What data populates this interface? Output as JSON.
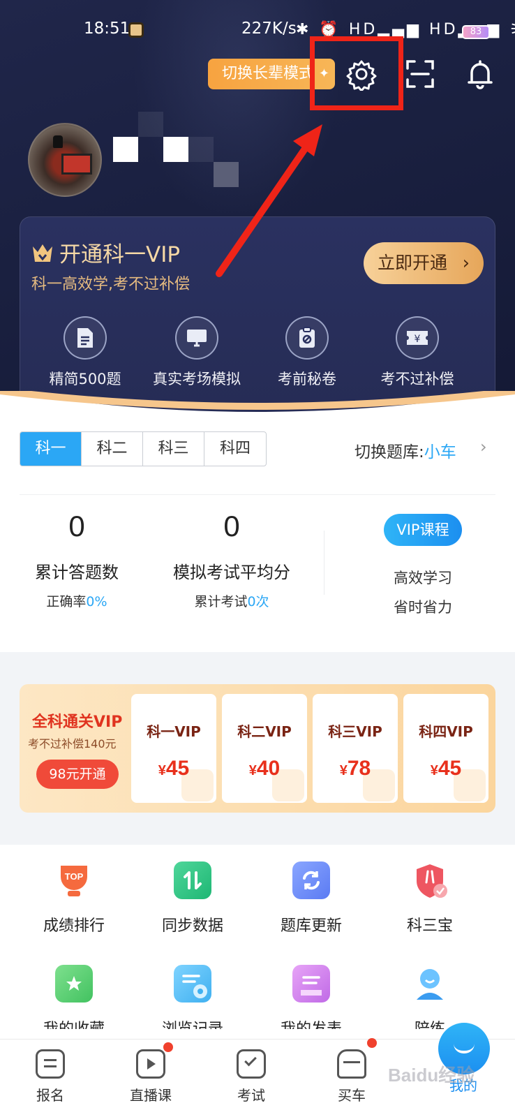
{
  "status_bar": {
    "time": "18:51",
    "speed": "227K/s",
    "icons": "✱ ⏰ HD▂▄▆ HD▂▄▆ ⚞",
    "battery": "83"
  },
  "header": {
    "elder_mode_label": "切换长辈模式",
    "highlight_color": "#ef2418"
  },
  "vip_card": {
    "title": "开通科一VIP",
    "subtitle": "科一高效学,考不过补偿",
    "open_button": "立即开通",
    "features": [
      {
        "label": "精简500题",
        "icon": "document-icon"
      },
      {
        "label": "真实考场模拟",
        "icon": "monitor-icon"
      },
      {
        "label": "考前秘卷",
        "icon": "secret-paper-icon"
      },
      {
        "label": "考不过补偿",
        "icon": "refund-ticket-icon"
      }
    ]
  },
  "subject_tabs": [
    "科一",
    "科二",
    "科三",
    "科四"
  ],
  "question_bank": {
    "label": "切换题库:",
    "value": "小车"
  },
  "stats": {
    "answered_count": "0",
    "answered_label": "累计答题数",
    "accuracy_label": "正确率",
    "accuracy_value": "0%",
    "avg_score": "0",
    "avg_score_label": "模拟考试平均分",
    "exam_count_label": "累计考试",
    "exam_count_value": "0次",
    "vip_course_button": "VIP课程",
    "vip_course_line1": "高效学习",
    "vip_course_line2": "省时省力"
  },
  "all_vip": {
    "title": "全科通关VIP",
    "subtitle": "考不过补偿140元",
    "button": "98元开通",
    "cards": [
      {
        "name": "科一VIP",
        "price": "45"
      },
      {
        "name": "科二VIP",
        "price": "40"
      },
      {
        "name": "科三VIP",
        "price": "78"
      },
      {
        "name": "科四VIP",
        "price": "45"
      }
    ],
    "currency": "¥"
  },
  "tools": [
    {
      "label": "成绩排行",
      "icon": "trophy-icon",
      "badge": "TOP"
    },
    {
      "label": "同步数据",
      "icon": "sync-icon"
    },
    {
      "label": "题库更新",
      "icon": "refresh-icon"
    },
    {
      "label": "科三宝",
      "icon": "shield-icon"
    },
    {
      "label": "我的收藏",
      "icon": "favorite-folder-icon"
    },
    {
      "label": "浏览记录",
      "icon": "history-icon"
    },
    {
      "label": "我的发表",
      "icon": "my-posts-icon"
    },
    {
      "label": "陪练",
      "icon": "coach-icon"
    }
  ],
  "bottom_nav": [
    {
      "label": "报名",
      "icon": "signup-icon"
    },
    {
      "label": "直播课",
      "icon": "live-tv-icon"
    },
    {
      "label": "考试",
      "icon": "exam-icon"
    },
    {
      "label": "买车",
      "icon": "car-icon"
    },
    {
      "label": "我的",
      "icon": "me-icon"
    }
  ],
  "watermark": "Baidu经验"
}
